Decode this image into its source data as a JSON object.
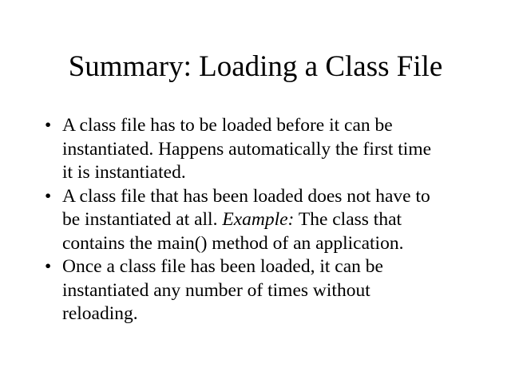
{
  "slide": {
    "title": "Summary: Loading a Class File",
    "bullet_glyph": "•",
    "bullets": [
      {
        "lines": [
          "A class file has to be loaded before it can be",
          "instantiated.  Happens automatically the first time",
          "it is instantiated."
        ]
      },
      {
        "line1": "A class file that has been loaded does not have to",
        "line2_text": "be instantiated at all.  ",
        "line2_emphasis": "Example:",
        "line2_rest": " The class that",
        "line3": "contains the main() method of an application."
      },
      {
        "lines": [
          "Once a class file has been loaded, it can be",
          "instantiated any number of times without",
          "reloading."
        ]
      }
    ]
  }
}
